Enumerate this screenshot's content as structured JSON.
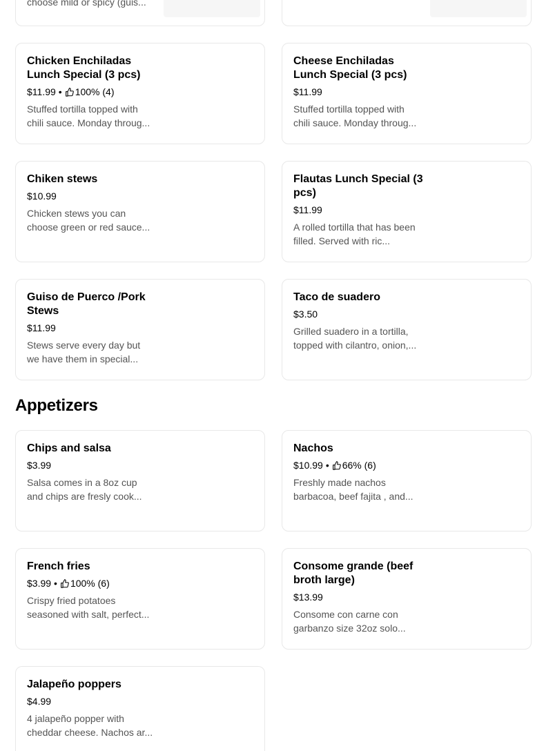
{
  "top_cards": [
    {
      "desc": "choose mild or spicy (guis..."
    },
    {
      "desc": ""
    }
  ],
  "specials": [
    {
      "title": "Chicken Enchiladas Lunch Special (3 pcs)",
      "price": "$11.99",
      "rating": "100% (4)",
      "desc": "Stuffed tortilla topped with chili sauce. Monday throug..."
    },
    {
      "title": "Cheese Enchiladas Lunch Special (3 pcs)",
      "price": "$11.99",
      "rating": "",
      "desc": "Stuffed tortilla topped with chili sauce. Monday throug..."
    },
    {
      "title": "Chiken stews",
      "price": "$10.99",
      "rating": "",
      "desc": "Chicken stews you can choose green or red sauce..."
    },
    {
      "title": "Flautas Lunch Special (3 pcs)",
      "price": "$11.99",
      "rating": "",
      "desc": "A rolled tortilla that has been filled. Served with ric..."
    },
    {
      "title": "Guiso de Puerco /Pork Stews",
      "price": "$11.99",
      "rating": "",
      "desc": "Stews serve every day but we have them in special..."
    },
    {
      "title": "Taco de suadero",
      "price": "$3.50",
      "rating": "",
      "desc": "Grilled suadero in a tortilla, topped with cilantro, onion,..."
    }
  ],
  "appetizers": {
    "heading": "Appetizers",
    "items": [
      {
        "title": "Chips and salsa",
        "price": "$3.99",
        "rating": "",
        "desc": "Salsa comes in a 8oz cup and chips are fresly cook..."
      },
      {
        "title": "Nachos",
        "price": "$10.99",
        "rating": "66% (6)",
        "desc": "Freshly made nachos barbacoa, beef fajita , and..."
      },
      {
        "title": "French fries",
        "price": "$3.99",
        "rating": "100% (6)",
        "desc": "Crispy fried potatoes seasoned with salt, perfect..."
      },
      {
        "title": "Consome grande (beef broth large)",
        "price": "$13.99",
        "rating": "",
        "desc": "Consome con carne con garbanzo size 32oz solo..."
      },
      {
        "title": "Jalapeño poppers",
        "price": "$4.99",
        "rating": "",
        "desc": "4 jalapeño popper with cheddar cheese. Nachos ar..."
      }
    ]
  }
}
